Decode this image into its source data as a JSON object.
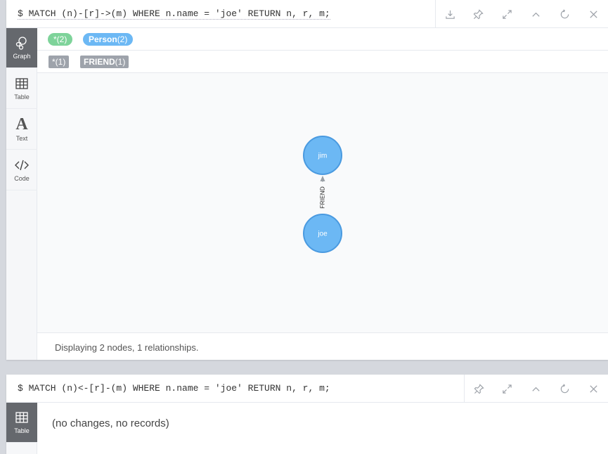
{
  "frames": [
    {
      "query": "$ MATCH (n)-[r]->(m) WHERE n.name = 'joe' RETURN n, r, m;",
      "actions": [
        "download-icon",
        "pin-icon",
        "expand-icon",
        "collapse-icon",
        "rerun-icon",
        "close-icon"
      ],
      "sidebar": [
        {
          "label": "Graph",
          "icon": "graph-icon"
        },
        {
          "label": "Table",
          "icon": "table-icon"
        },
        {
          "label": "Text",
          "icon": "text-icon"
        },
        {
          "label": "Code",
          "icon": "code-icon"
        }
      ],
      "legend_nodes": [
        {
          "name": "*",
          "count": "(2)",
          "color": "#7ed39a"
        },
        {
          "name": "Person",
          "count": "(2)",
          "color": "#6cb8f4"
        }
      ],
      "legend_rels": [
        {
          "name": "*",
          "count": "(1)"
        },
        {
          "name": "FRIEND",
          "count": "(1)"
        }
      ],
      "graph": {
        "nodes": [
          {
            "id": "jim",
            "label": "jim",
            "color": "#6cb8f4"
          },
          {
            "id": "joe",
            "label": "joe",
            "color": "#6cb8f4"
          }
        ],
        "relationships": [
          {
            "from": "joe",
            "to": "jim",
            "type": "FRIEND"
          }
        ]
      },
      "status": "Displaying 2 nodes, 1 relationships."
    },
    {
      "query": "$ MATCH (n)<-[r]-(m) WHERE n.name = 'joe' RETURN n, r, m;",
      "actions": [
        "pin-icon",
        "expand-icon",
        "collapse-icon",
        "rerun-icon",
        "close-icon"
      ],
      "sidebar": [
        {
          "label": "Table",
          "icon": "table-icon"
        }
      ],
      "message": "(no changes, no records)"
    }
  ]
}
